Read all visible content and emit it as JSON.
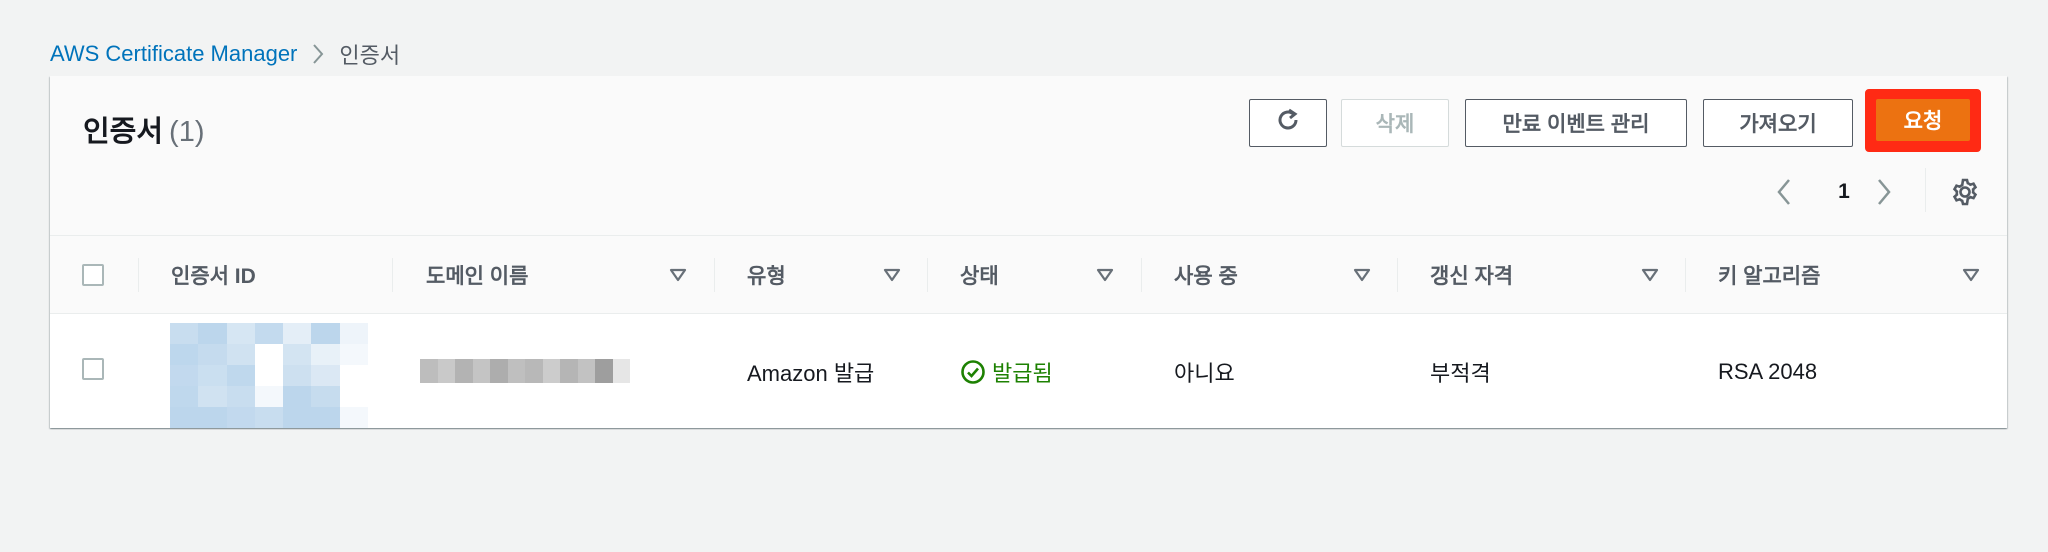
{
  "breadcrumb": {
    "root": "AWS Certificate Manager",
    "current": "인증서"
  },
  "panel": {
    "title": "인증서",
    "count": "(1)"
  },
  "toolbar": {
    "refresh_icon": "refresh-icon",
    "delete_label": "삭제",
    "expiry_label": "만료 이벤트 관리",
    "import_label": "가져오기",
    "request_label": "요청"
  },
  "pagination": {
    "current_page": "1"
  },
  "table": {
    "columns": [
      {
        "label": "인증서 ID"
      },
      {
        "label": "도메인 이름"
      },
      {
        "label": "유형"
      },
      {
        "label": "상태"
      },
      {
        "label": "사용 중"
      },
      {
        "label": "갱신 자격"
      },
      {
        "label": "키 알고리즘"
      }
    ],
    "rows": [
      {
        "type": "Amazon 발급",
        "status": "발급됨",
        "in_use": "아니요",
        "renewal": "부적격",
        "key_algorithm": "RSA 2048"
      }
    ]
  },
  "colors": {
    "link": "#0073bb",
    "primary": "#ec7211",
    "highlight": "#ff2a14",
    "success": "#1d8102"
  }
}
